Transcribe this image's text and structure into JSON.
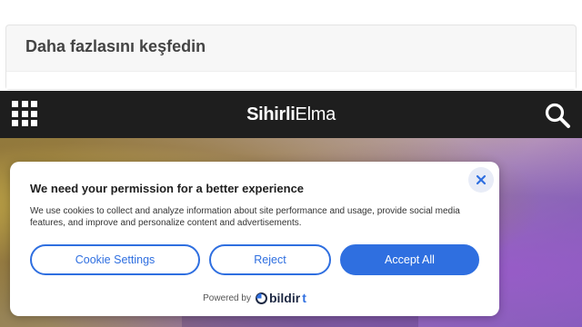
{
  "discover": {
    "title": "Daha fazlasını keşfedin"
  },
  "header": {
    "menu_icon": "grid-menu-icon",
    "logo_strong": "Sihirli",
    "logo_light": "Elma",
    "search_icon": "search-icon"
  },
  "consent": {
    "title": "We need your permission for a better experience",
    "body": "We use cookies to collect and analyze information about site performance and usage, provide social media features, and improve and personalize content and advertisements.",
    "buttons": {
      "settings": "Cookie Settings",
      "reject": "Reject",
      "accept": "Accept All"
    },
    "close_icon": "close-icon",
    "powered_by": "Powered by",
    "brand_main": "bildir",
    "brand_accent": "t"
  },
  "colors": {
    "accent": "#2f6fe0",
    "header_bg": "#1e1e1e"
  }
}
